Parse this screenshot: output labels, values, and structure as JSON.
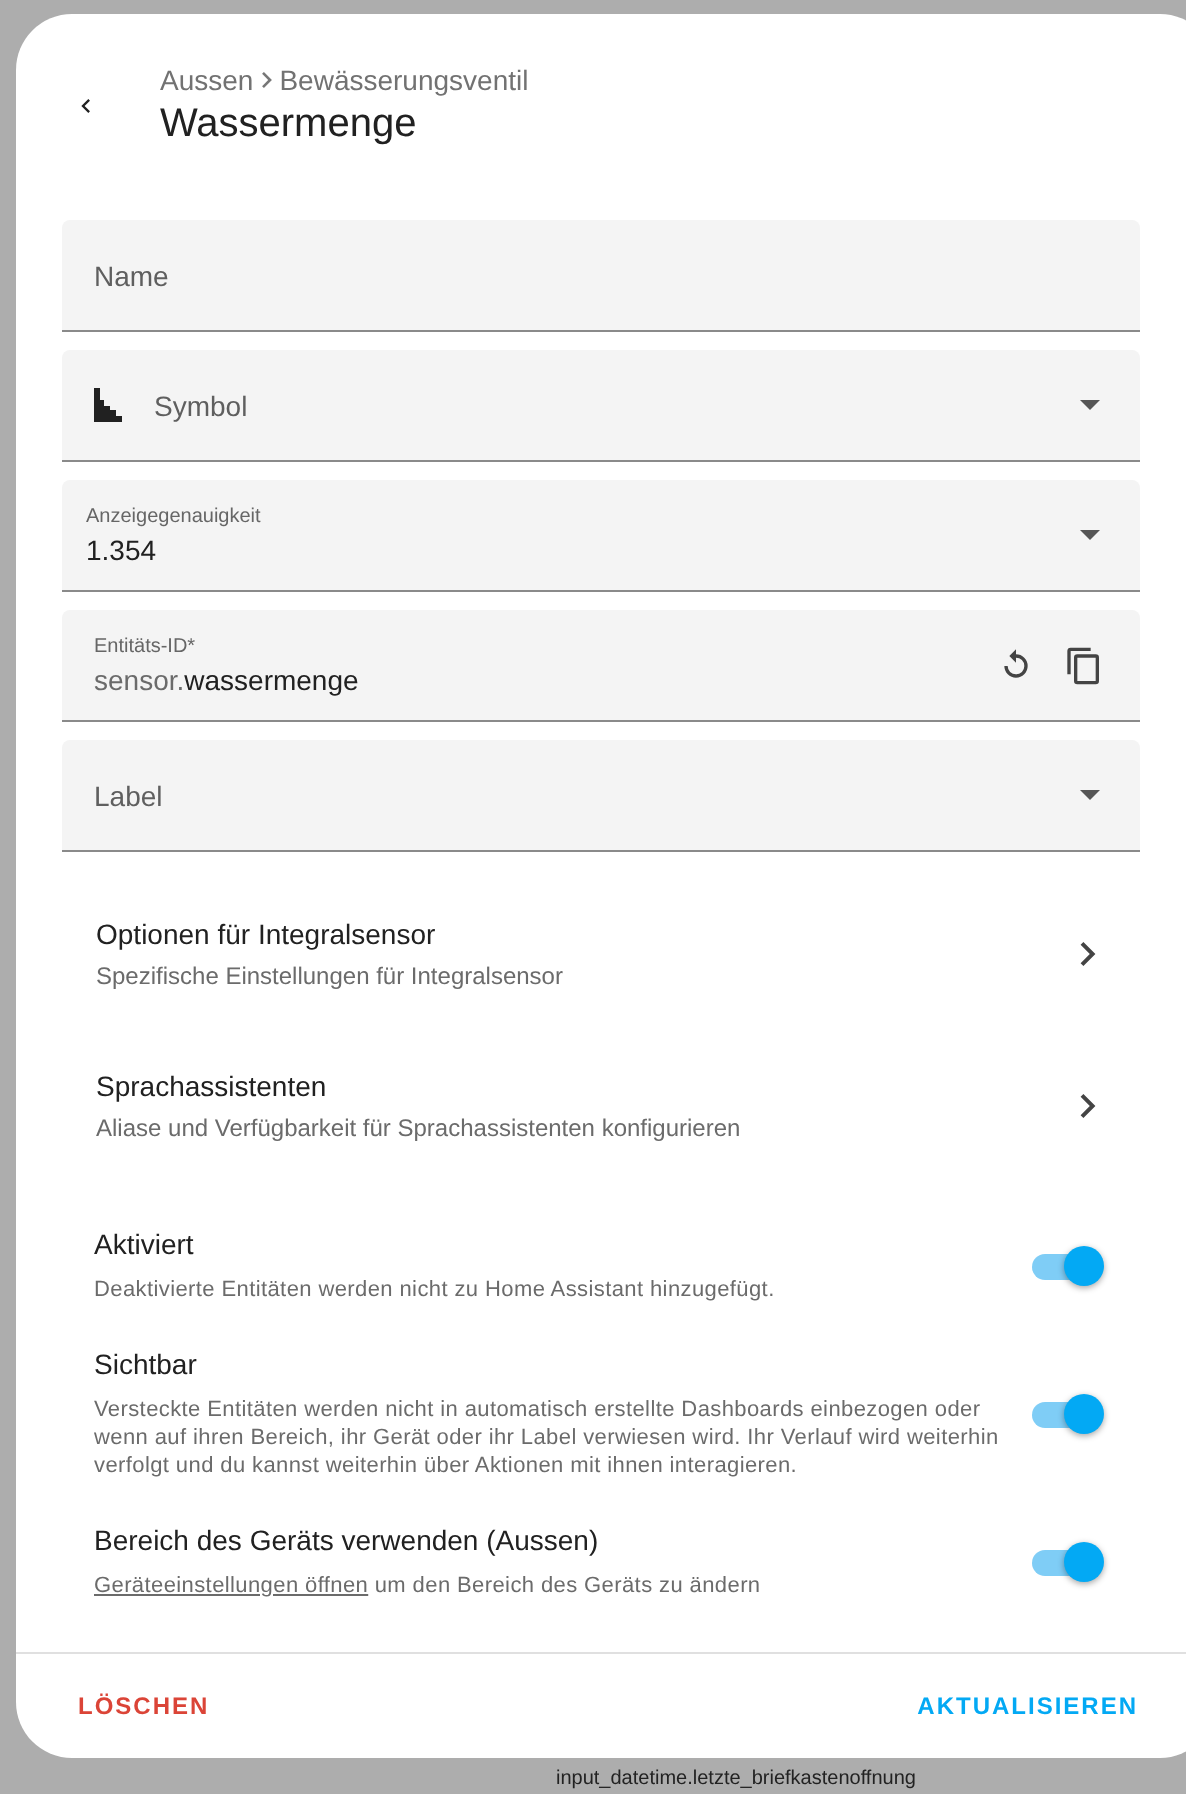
{
  "header": {
    "breadcrumb": [
      "Aussen",
      "Bewässerungsventil"
    ],
    "title": "Wassermenge"
  },
  "fields": [
    {
      "kind": "text",
      "label": "Name"
    },
    {
      "kind": "icon-select",
      "label": "Symbol"
    },
    {
      "kind": "select",
      "label": "Anzeigegenauigkeit",
      "value": "1.354"
    },
    {
      "kind": "entity-id",
      "label": "Entitäts-ID*",
      "prefix": "sensor.",
      "value": "wassermenge"
    },
    {
      "kind": "select-empty",
      "label": "Label"
    }
  ],
  "nav_rows": [
    {
      "title": "Optionen für Integralsensor",
      "subtitle": "Spezifische Einstellungen für Integralsensor"
    },
    {
      "title": "Sprachassistenten",
      "subtitle": "Aliase und Verfügbarkeit für Sprachassistenten konfigurieren"
    }
  ],
  "toggles": [
    {
      "title": "Aktiviert",
      "description": "Deaktivierte Entitäten werden nicht zu Home Assistant hinzugefügt.",
      "on": true
    },
    {
      "title": "Sichtbar",
      "description": "Versteckte Entitäten werden nicht in automatisch erstellte Dashboards einbezogen oder wenn auf ihren Bereich, ihr Gerät oder ihr Label verwiesen wird. Ihr Verlauf wird weiterhin verfolgt und du kannst weiterhin über Aktionen mit ihnen interagieren.",
      "on": true
    },
    {
      "title": "Bereich des Geräts verwenden (Aussen)",
      "link": "Geräteeinstellungen öffnen",
      "description": "um den Bereich des Geräts zu ändern",
      "on": true
    }
  ],
  "actions": {
    "delete": "LÖSCHEN",
    "update": "AKTUALISIEREN"
  },
  "background_text": "input_datetime.letzte_briefkastenoffnung"
}
